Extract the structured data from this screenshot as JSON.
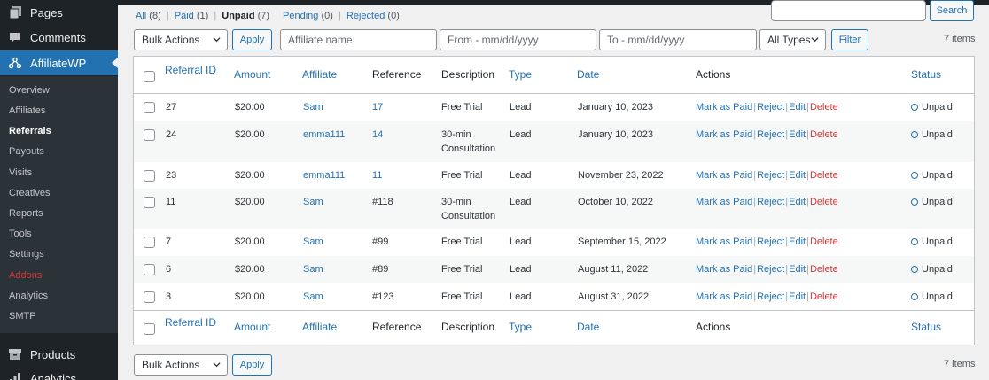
{
  "sidebar": {
    "top_items": [
      {
        "label": "Pages",
        "icon": "pages-icon"
      },
      {
        "label": "Comments",
        "icon": "comments-icon"
      },
      {
        "label": "AffiliateWP",
        "icon": "affiliatewp-icon"
      }
    ],
    "sub_items": [
      "Overview",
      "Affiliates",
      "Referrals",
      "Payouts",
      "Visits",
      "Creatives",
      "Reports",
      "Tools",
      "Settings",
      "Addons",
      "Analytics",
      "SMTP"
    ],
    "bottom_items": [
      {
        "label": "Products",
        "icon": "products-icon"
      },
      {
        "label": "Analytics",
        "icon": "analytics-icon"
      }
    ]
  },
  "filters": {
    "views": [
      {
        "label": "All",
        "count": "(8)"
      },
      {
        "label": "Paid",
        "count": "(1)"
      },
      {
        "label": "Unpaid",
        "count": "(7)"
      },
      {
        "label": "Pending",
        "count": "(0)"
      },
      {
        "label": "Rejected",
        "count": "(0)"
      }
    ],
    "current_view": "Unpaid"
  },
  "search": {
    "button": "Search"
  },
  "toolbar": {
    "bulk_actions": "Bulk Actions",
    "apply": "Apply",
    "affiliate_placeholder": "Affiliate name",
    "from_placeholder": "From - mm/dd/yyyy",
    "to_placeholder": "To - mm/dd/yyyy",
    "types": "All Types",
    "filter": "Filter",
    "items_count": "7 items"
  },
  "table": {
    "columns": [
      "Referral ID",
      "Amount",
      "Affiliate",
      "Reference",
      "Description",
      "Type",
      "Date",
      "Actions",
      "Status"
    ],
    "actions": [
      "Mark as Paid",
      "Reject",
      "Edit",
      "Delete"
    ],
    "rows": [
      {
        "id": "27",
        "amount": "$20.00",
        "affiliate": "Sam",
        "reference": "17",
        "desc1": "Free Trial",
        "desc2": "",
        "type": "Lead",
        "date": "January 10, 2023",
        "status": "Unpaid"
      },
      {
        "id": "24",
        "amount": "$20.00",
        "affiliate": "emma111",
        "reference": "14",
        "desc1": "30-min",
        "desc2": "Consultation",
        "type": "Lead",
        "date": "January 10, 2023",
        "status": "Unpaid"
      },
      {
        "id": "23",
        "amount": "$20.00",
        "affiliate": "emma111",
        "reference": "11",
        "desc1": "Free Trial",
        "desc2": "",
        "type": "Lead",
        "date": "November 23, 2022",
        "status": "Unpaid"
      },
      {
        "id": "11",
        "amount": "$20.00",
        "affiliate": "Sam",
        "reference": "#118",
        "desc1": "30-min",
        "desc2": "Consultation",
        "type": "Lead",
        "date": "October 10, 2022",
        "status": "Unpaid"
      },
      {
        "id": "7",
        "amount": "$20.00",
        "affiliate": "Sam",
        "reference": "#99",
        "desc1": "Free Trial",
        "desc2": "",
        "type": "Lead",
        "date": "September 15, 2022",
        "status": "Unpaid"
      },
      {
        "id": "6",
        "amount": "$20.00",
        "affiliate": "Sam",
        "reference": "#89",
        "desc1": "Free Trial",
        "desc2": "",
        "type": "Lead",
        "date": "August 11, 2022",
        "status": "Unpaid"
      },
      {
        "id": "3",
        "amount": "$20.00",
        "affiliate": "Sam",
        "reference": "#123",
        "desc1": "Free Trial",
        "desc2": "",
        "type": "Lead",
        "date": "August 31, 2022",
        "status": "Unpaid"
      }
    ]
  },
  "colors": {
    "accent": "#2271b1",
    "delete": "#d63638",
    "sidebar": "#1d2327"
  }
}
